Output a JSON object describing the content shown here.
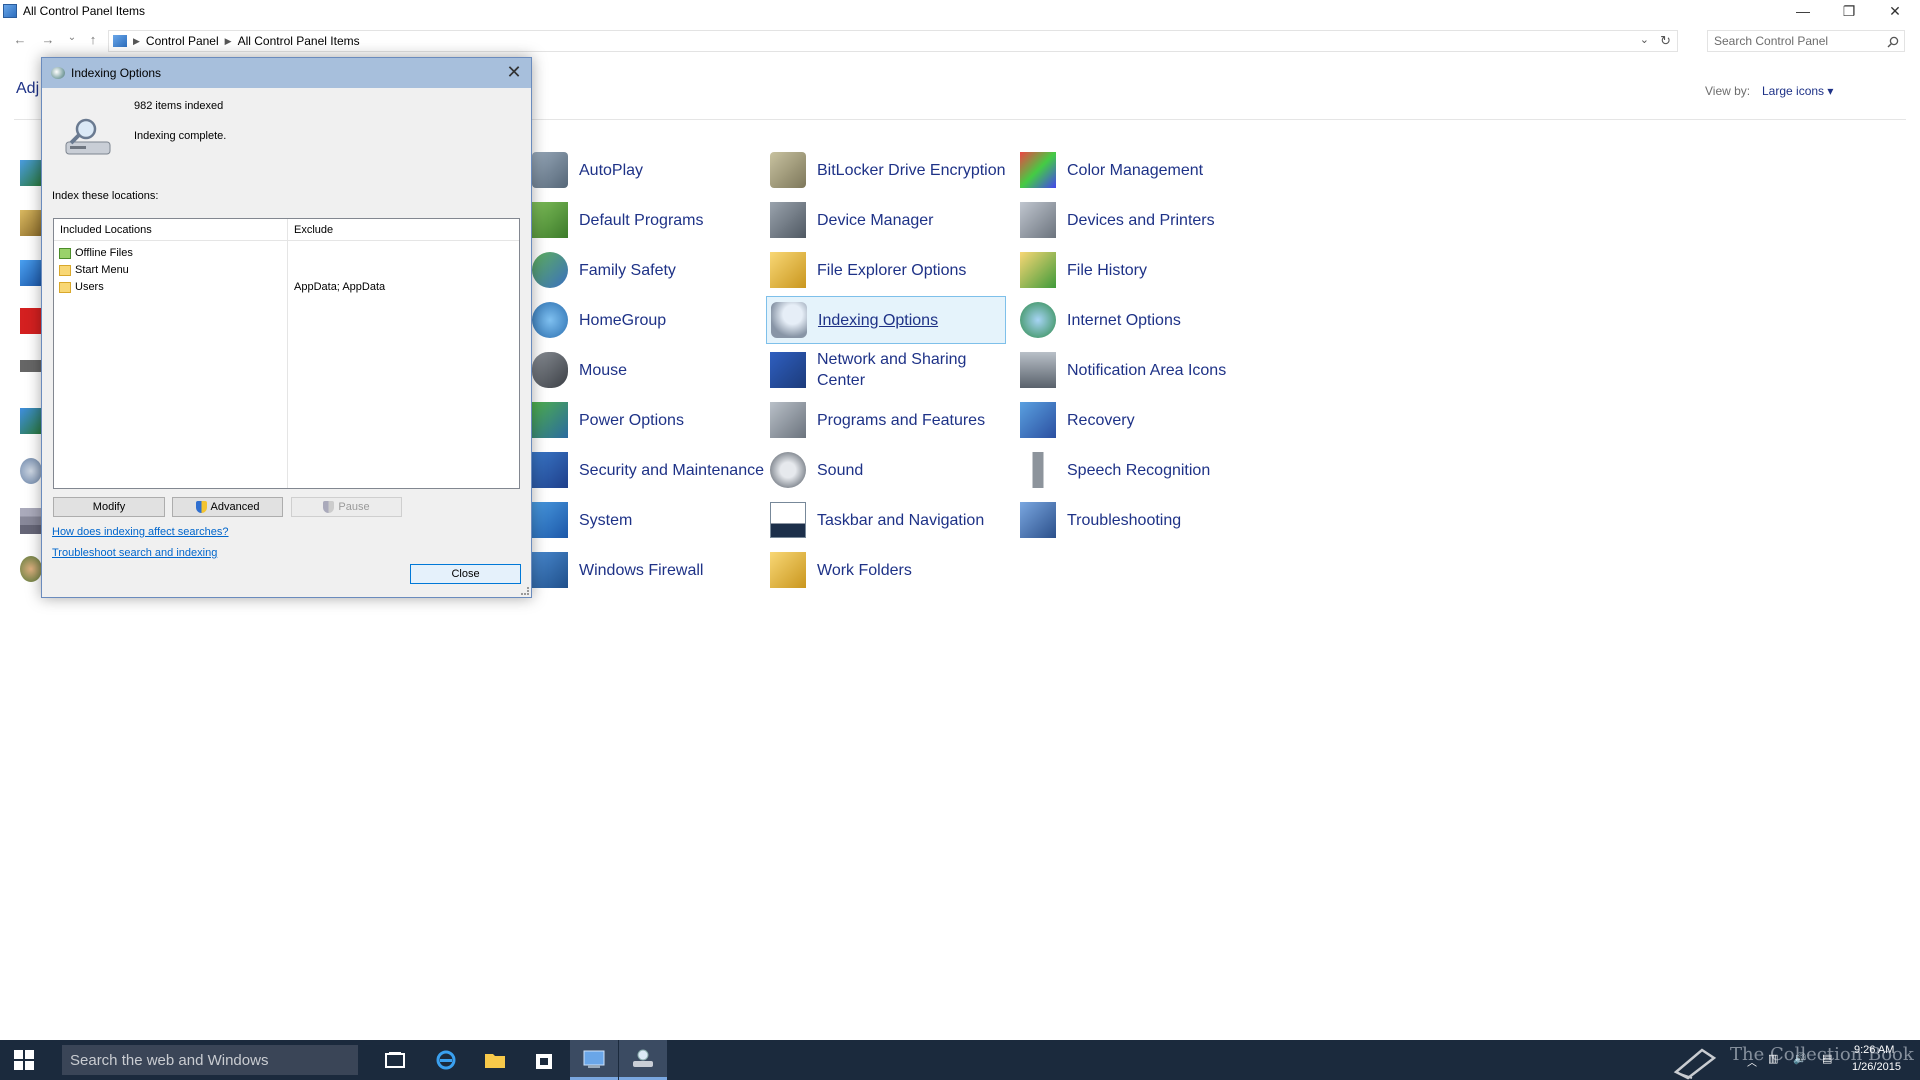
{
  "window": {
    "title": "All Control Panel Items",
    "controls": {
      "minimize": "—",
      "restore": "❐",
      "close": "✕"
    }
  },
  "address": {
    "nav": {
      "back": "←",
      "forward": "→",
      "recent": "⌄",
      "up": "↑"
    },
    "crumbs": [
      "Control Panel",
      "All Control Panel Items"
    ],
    "dropdown": "⌄",
    "refresh": "↻",
    "search_placeholder": "Search Control Panel"
  },
  "header": {
    "adjust_partial": "Adj",
    "view_by_label": "View by:",
    "view_by_value": "Large icons ▾"
  },
  "items": [
    {
      "label": "AutoPlay",
      "icon": "autoplay-icon"
    },
    {
      "label": "BitLocker Drive Encryption",
      "icon": "bitlocker-icon"
    },
    {
      "label": "Color Management",
      "icon": "color-management-icon"
    },
    {
      "label": "Default Programs",
      "icon": "default-programs-icon"
    },
    {
      "label": "Device Manager",
      "icon": "device-manager-icon"
    },
    {
      "label": "Devices and Printers",
      "icon": "devices-printers-icon"
    },
    {
      "label": "Family Safety",
      "icon": "family-safety-icon"
    },
    {
      "label": "File Explorer Options",
      "icon": "folder-options-icon"
    },
    {
      "label": "File History",
      "icon": "file-history-icon"
    },
    {
      "label": "HomeGroup",
      "icon": "homegroup-icon"
    },
    {
      "label": "Indexing Options",
      "icon": "indexing-icon"
    },
    {
      "label": "Internet Options",
      "icon": "internet-options-icon"
    },
    {
      "label": "Mouse",
      "icon": "mouse-icon"
    },
    {
      "label": "Network and Sharing Center",
      "icon": "network-icon"
    },
    {
      "label": "Notification Area Icons",
      "icon": "notification-icon"
    },
    {
      "label": "Power Options",
      "icon": "power-icon"
    },
    {
      "label": "Programs and Features",
      "icon": "programs-icon"
    },
    {
      "label": "Recovery",
      "icon": "recovery-icon"
    },
    {
      "label": "Security and Maintenance",
      "icon": "security-icon"
    },
    {
      "label": "Sound",
      "icon": "sound-icon"
    },
    {
      "label": "Speech Recognition",
      "icon": "microphone-icon"
    },
    {
      "label": "System",
      "icon": "system-icon"
    },
    {
      "label": "Taskbar and Navigation",
      "icon": "taskbar-icon"
    },
    {
      "label": "Troubleshooting",
      "icon": "troubleshooting-icon"
    },
    {
      "label": "Windows Firewall",
      "icon": "firewall-icon"
    },
    {
      "label": "Work Folders",
      "icon": "work-folders-icon"
    }
  ],
  "dialog": {
    "title": "Indexing Options",
    "close_glyph": "✕",
    "items_indexed": "982 items indexed",
    "status": "Indexing complete.",
    "index_label": "Index these locations:",
    "columns": [
      "Included Locations",
      "Exclude"
    ],
    "rows": [
      {
        "location": "Offline Files",
        "exclude": ""
      },
      {
        "location": "Start Menu",
        "exclude": ""
      },
      {
        "location": "Users",
        "exclude": "AppData; AppData"
      }
    ],
    "buttons": {
      "modify": "Modify",
      "advanced": "Advanced",
      "pause": "Pause",
      "close": "Close"
    },
    "links": [
      "How does indexing affect searches?",
      "Troubleshoot search and indexing"
    ]
  },
  "taskbar": {
    "search_placeholder": "Search the web and Windows",
    "time": "9:26 AM",
    "date": "1/26/2015",
    "watermark": "The Collection Book"
  },
  "colors": {
    "link": "#1e3287",
    "selection": "#e5f3fb",
    "taskbar": "#1b2a3d"
  }
}
